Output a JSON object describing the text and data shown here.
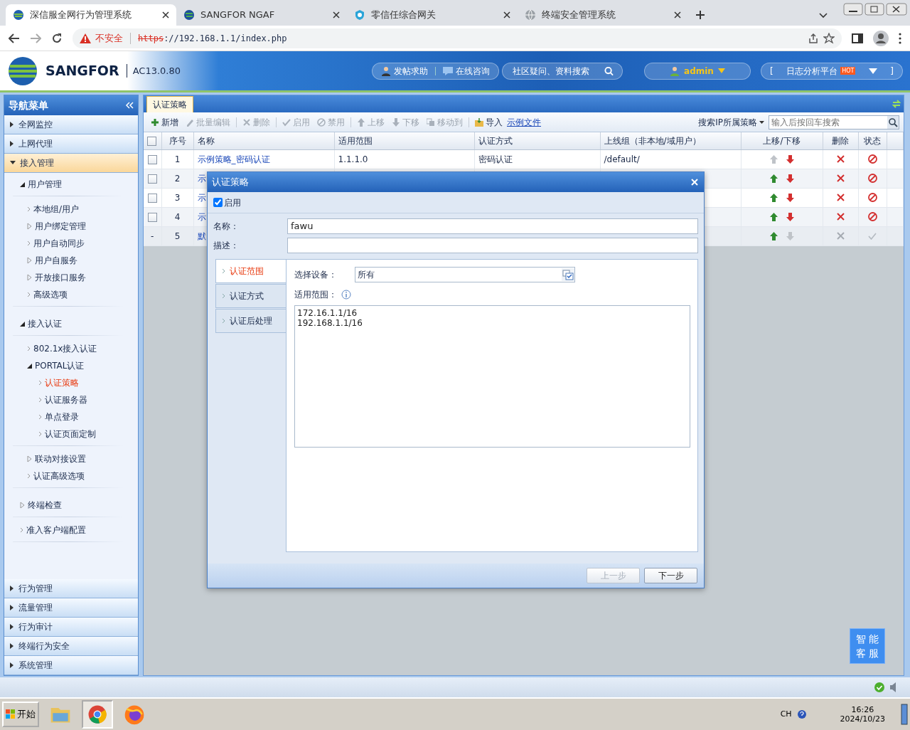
{
  "browser": {
    "tabs": [
      {
        "title": "深信服全网行为管理系统",
        "selected": true
      },
      {
        "title": "SANGFOR NGAF",
        "selected": false
      },
      {
        "title": "零信任综合网关",
        "selected": false
      },
      {
        "title": "终端安全管理系统",
        "selected": false
      }
    ],
    "security_label": "不安全",
    "url_scheme": "https",
    "url_rest": "://192.168.1.1/index.php"
  },
  "header": {
    "brand": "SANGFOR",
    "version": "AC13.0.80",
    "links": [
      "发帖求助",
      "在线咨询"
    ],
    "search_placeholder": "社区疑问、资料搜索",
    "user": "admin",
    "log_bracket_open": "[",
    "log_platform": "日志分析平台",
    "hot_badge": "HOT",
    "log_bracket_close": "]"
  },
  "sidebar": {
    "title": "导航菜单",
    "sections": [
      {
        "label": "全网监控",
        "expanded": false
      },
      {
        "label": "上网代理",
        "expanded": false
      },
      {
        "label": "接入管理",
        "expanded": true,
        "children": [
          {
            "label": "用户管理",
            "kind": "group",
            "expanded": true,
            "selected": false,
            "children": [
              {
                "label": "本地组/用户",
                "kind": "leaf",
                "selected": false
              },
              {
                "label": "用户绑定管理",
                "kind": "group",
                "expanded": false,
                "selected": false
              },
              {
                "label": "用户自动同步",
                "kind": "leaf",
                "selected": false
              },
              {
                "label": "用户自服务",
                "kind": "group",
                "expanded": false,
                "selected": false
              },
              {
                "label": "开放接口服务",
                "kind": "group",
                "expanded": false,
                "selected": false
              },
              {
                "label": "高级选项",
                "kind": "leaf",
                "selected": false
              }
            ]
          },
          {
            "label": "接入认证",
            "kind": "group",
            "expanded": true,
            "selected": false,
            "children": [
              {
                "label": "802.1x接入认证",
                "kind": "leaf",
                "selected": false
              },
              {
                "label": "PORTAL认证",
                "kind": "group",
                "expanded": true,
                "selected": false,
                "children": [
                  {
                    "label": "认证策略",
                    "kind": "leaf",
                    "selected": true
                  },
                  {
                    "label": "认证服务器",
                    "kind": "leaf",
                    "selected": false
                  },
                  {
                    "label": "单点登录",
                    "kind": "leaf",
                    "selected": false
                  },
                  {
                    "label": "认证页面定制",
                    "kind": "leaf",
                    "selected": false
                  }
                ]
              },
              {
                "label": "联动对接设置",
                "kind": "group",
                "expanded": false,
                "selected": false
              },
              {
                "label": "认证高级选项",
                "kind": "leaf",
                "selected": false
              }
            ]
          },
          {
            "label": "终端检查",
            "kind": "group",
            "expanded": false,
            "selected": false
          },
          {
            "label": "准入客户端配置",
            "kind": "leaf",
            "selected": false
          }
        ]
      },
      {
        "label": "行为管理",
        "expanded": false
      },
      {
        "label": "流量管理",
        "expanded": false
      },
      {
        "label": "行为审计",
        "expanded": false
      },
      {
        "label": "终端行为安全",
        "expanded": false
      },
      {
        "label": "系统管理",
        "expanded": false
      }
    ]
  },
  "main": {
    "tab": "认证策略",
    "toolbar": [
      {
        "label": "新增",
        "kind": "add",
        "disabled": false
      },
      {
        "label": "批量编辑",
        "kind": "edit",
        "disabled": true
      },
      {
        "label": "删除",
        "kind": "delete",
        "disabled": true
      },
      {
        "label": "启用",
        "kind": "enable",
        "disabled": true
      },
      {
        "label": "禁用",
        "kind": "disable",
        "disabled": true
      },
      {
        "label": "上移",
        "kind": "up",
        "disabled": true
      },
      {
        "label": "下移",
        "kind": "down",
        "disabled": true
      },
      {
        "label": "移动到",
        "kind": "move",
        "disabled": true
      },
      {
        "label": "导入",
        "kind": "import",
        "disabled": false
      }
    ],
    "sample_link": "示例文件",
    "search_label": "搜索IP所属策略",
    "search_placeholder": "输入后按回车搜索",
    "table": {
      "all_checked": false,
      "columns": [
        "序号",
        "名称",
        "适用范围",
        "认证方式",
        "上线组（非本地/域用户）",
        "上移/下移",
        "删除",
        "状态"
      ],
      "rows": [
        {
          "kind": "policy",
          "checked": false,
          "seq": "1",
          "name": "示例策略_密码认证",
          "scope": "1.1.1.0",
          "method": "密码认证",
          "group": "/default/",
          "up_enabled": false,
          "down_enabled": true,
          "deletable": true,
          "enabled": false
        },
        {
          "kind": "policy",
          "checked": false,
          "seq": "2",
          "name": "示",
          "up_enabled": true,
          "down_enabled": true,
          "deletable": true,
          "enabled": false
        },
        {
          "kind": "policy",
          "checked": false,
          "seq": "3",
          "name": "示",
          "up_enabled": true,
          "down_enabled": true,
          "deletable": true,
          "enabled": false
        },
        {
          "kind": "policy",
          "checked": false,
          "seq": "4",
          "name": "示",
          "up_enabled": true,
          "down_enabled": true,
          "deletable": true,
          "enabled": false
        },
        {
          "kind": "default",
          "marker": "-",
          "seq": "5",
          "name": "默",
          "up_enabled": true,
          "down_enabled": false,
          "deletable": false,
          "enabled": true
        }
      ]
    }
  },
  "dialog": {
    "title": "认证策略",
    "enable_label": "启用",
    "enable_checked": true,
    "fields": [
      {
        "label": "名称：",
        "value": "fawu"
      },
      {
        "label": "描述："
      }
    ],
    "side_tabs": [
      {
        "label": "认证范围",
        "selected": true
      },
      {
        "label": "认证方式",
        "selected": false
      },
      {
        "label": "认证后处理",
        "selected": false
      }
    ],
    "device_label": "选择设备：",
    "device_value": "所有",
    "scope_label": "适用范围：",
    "scope_lines": [
      "172.16.1.1/16",
      "192.168.1.1/16"
    ],
    "buttons": [
      {
        "label": "上一步",
        "disabled": true
      },
      {
        "label": "下一步",
        "disabled": false
      }
    ]
  },
  "assistant": [
    "智 能",
    "客 服"
  ],
  "taskbar": {
    "start": "开始",
    "apps": [
      {
        "kind": "folder",
        "selected": false
      },
      {
        "kind": "chrome",
        "selected": true
      },
      {
        "kind": "firefox",
        "selected": false
      }
    ],
    "lang": "CH",
    "time": "16:26",
    "date": "2024/10/23"
  }
}
